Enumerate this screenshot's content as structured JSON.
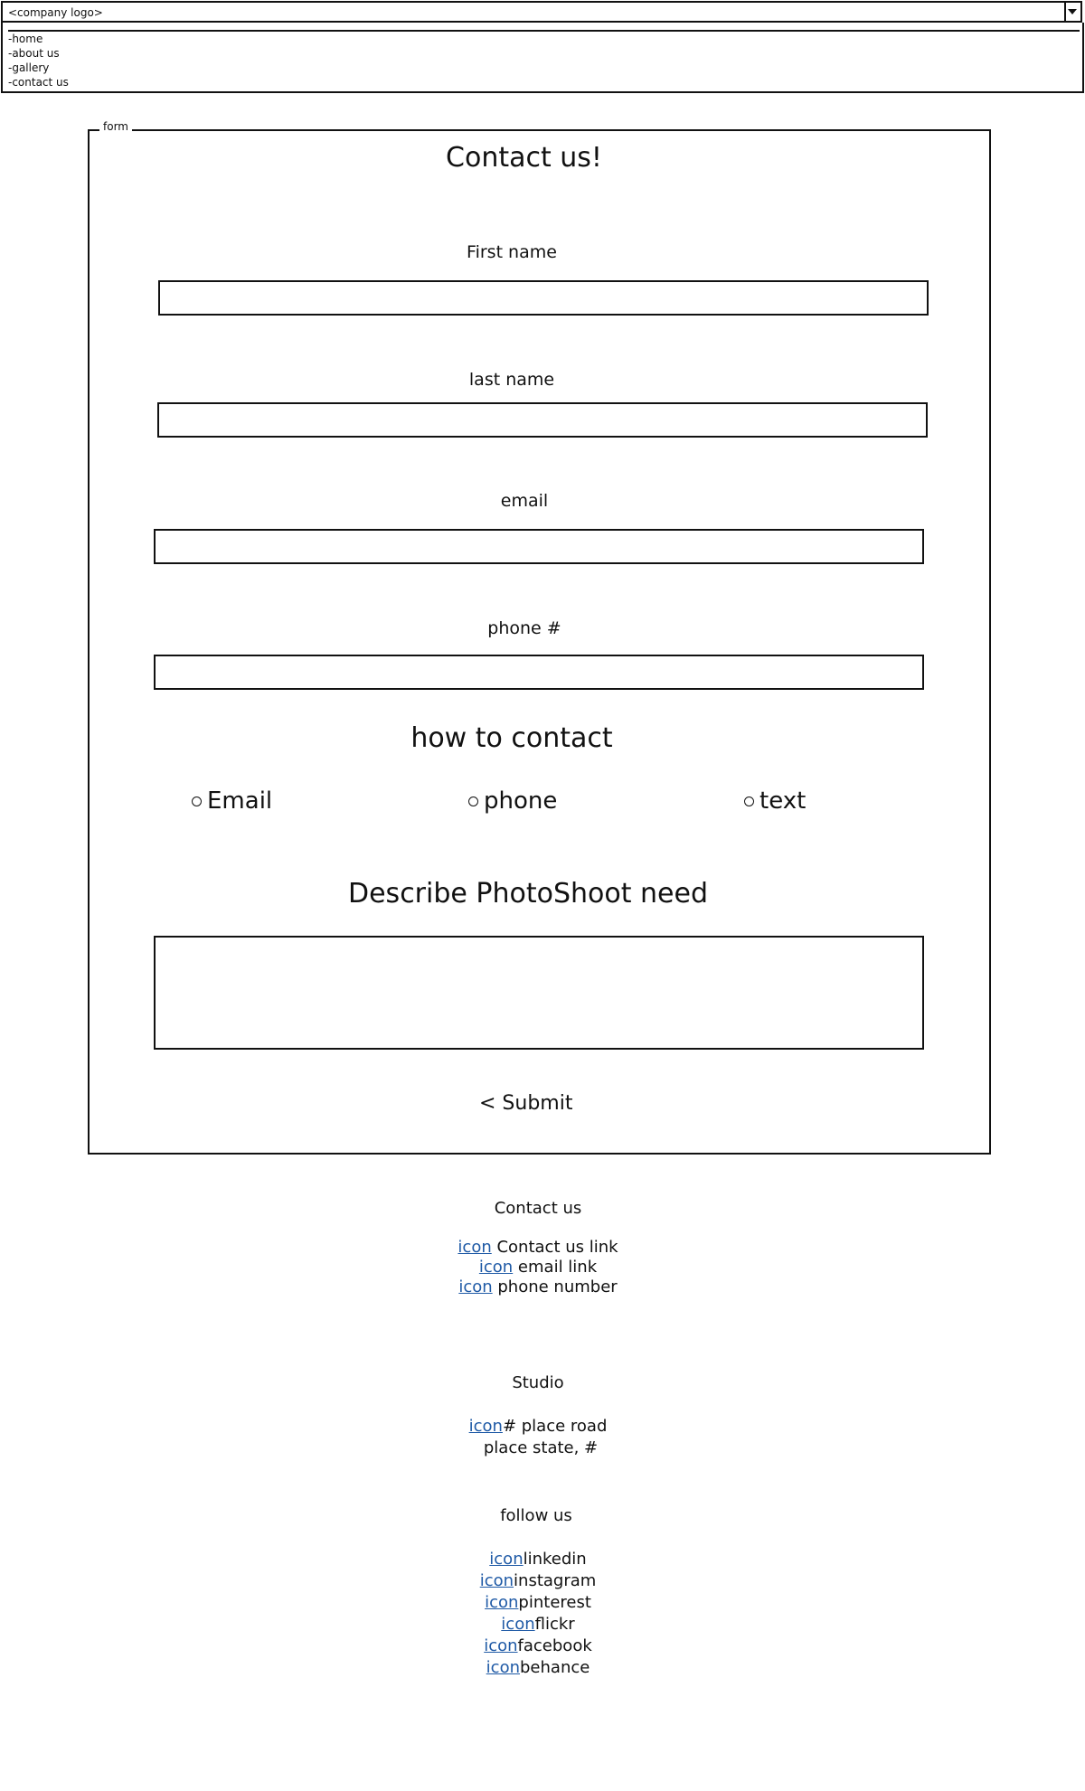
{
  "header": {
    "logo_text": "<company logo>",
    "menu": [
      "-home",
      "-about us",
      "-gallery",
      "-contact us"
    ]
  },
  "form": {
    "legend": "form",
    "title": "Contact us!",
    "fields": {
      "first_name_label": "First name",
      "last_name_label": "last name",
      "email_label": "email",
      "phone_label": "phone #"
    },
    "how_to_contact": "how to contact",
    "radio_options": [
      "Email",
      "phone",
      "text"
    ],
    "describe_label": "Describe PhotoShoot need",
    "submit_label": "< Submit"
  },
  "footer": {
    "contact_title": "Contact us",
    "icon_text": "icon",
    "contact_links": [
      " Contact us link",
      " email link",
      " phone number"
    ],
    "studio_title": "Studio",
    "studio_line1": "# place road",
    "studio_line2": "place state, #",
    "follow_title": "follow us",
    "social": [
      "linkedin",
      "instagram",
      "pinterest",
      "flickr",
      "facebook",
      "behance"
    ]
  },
  "colors": {
    "link": "#1f5aa6",
    "border": "#111111"
  }
}
